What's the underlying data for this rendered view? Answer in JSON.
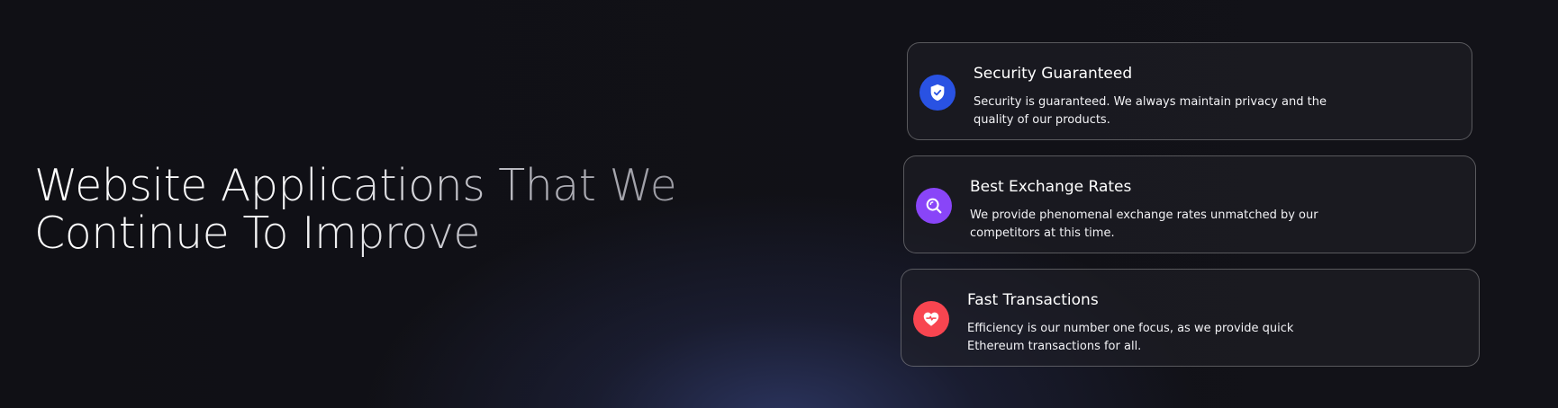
{
  "hero": {
    "title_line1": "Website Applications That We",
    "title_line2": "Continue To Improve"
  },
  "features": [
    {
      "title": "Security Guaranteed",
      "description": "Security is guaranteed. We always maintain privacy and the quality of our products.",
      "icon": "shield-check-icon",
      "icon_color": "#2952e3"
    },
    {
      "title": "Best Exchange Rates",
      "description": "We provide phenomenal exchange rates unmatched by our competitors at this time.",
      "icon": "search-icon",
      "icon_color": "#8945f8"
    },
    {
      "title": "Fast Transactions",
      "description": "Efficiency is our number one focus, as we provide quick Ethereum transactions for all.",
      "icon": "heart-icon",
      "icon_color": "#f84550"
    }
  ]
}
